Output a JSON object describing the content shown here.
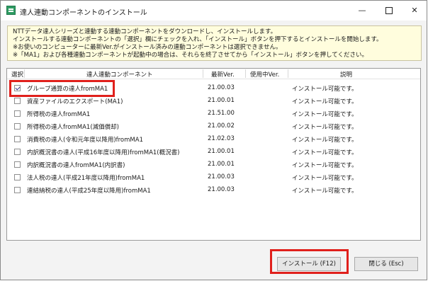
{
  "window": {
    "title": "達人連動コンポーネントのインストール",
    "minimize_glyph": "—",
    "close_glyph": "✕"
  },
  "info_lines": [
    "NTTデータ達人シリーズと連動する連動コンポーネントをダウンロードし、インストールします。",
    "インストールする連動コンポーネントの「選択」欄にチェックを入れ、「インストール」ボタンを押下するとインストールを開始します。",
    "※お使いのコンピューターに最新Ver.がインストール済みの連動コンポーネントは選択できません。",
    "※「MA1」および各種連動コンポーネントが起動中の場合は、それらを終了させてから「インストール」ボタンを押してください。"
  ],
  "table": {
    "headers": {
      "select": "選択",
      "component": "達人連動コンポーネント",
      "latest": "最新Ver.",
      "in_use": "使用中Ver.",
      "description": "説明"
    },
    "rows": [
      {
        "checked": true,
        "name": "グループ通算の達人fromMA1",
        "latest": "21.00.03",
        "desc": "インストール可能です。"
      },
      {
        "checked": false,
        "name": "資産ファイルのエクスポート(MA1)",
        "latest": "21.00.01",
        "desc": "インストール可能です。"
      },
      {
        "checked": false,
        "name": "所得税の達人fromMA1",
        "latest": "21.51.00",
        "desc": "インストール可能です。"
      },
      {
        "checked": false,
        "name": "所得税の達人fromMA1(減価償却)",
        "latest": "21.00.02",
        "desc": "インストール可能です。"
      },
      {
        "checked": false,
        "name": "消費税の達人(令和元年度以降用)fromMA1",
        "latest": "21.02.03",
        "desc": "インストール可能です。"
      },
      {
        "checked": false,
        "name": "内訳概況書の達人(平成16年度以降用)fromMA1(概況書)",
        "latest": "21.00.01",
        "desc": "インストール可能です。"
      },
      {
        "checked": false,
        "name": "内訳概況書の達人fromMA1(内訳書)",
        "latest": "21.00.01",
        "desc": "インストール可能です。"
      },
      {
        "checked": false,
        "name": "法人税の達人(平成21年度以降用)fromMA1",
        "latest": "21.00.03",
        "desc": "インストール可能です。"
      },
      {
        "checked": false,
        "name": "連結納税の達人(平成25年度以降用)fromMA1",
        "latest": "21.00.03",
        "desc": "インストール可能です。"
      }
    ]
  },
  "buttons": {
    "install": "インストール (F12)",
    "close": "閉じる (Esc)"
  },
  "colors": {
    "highlight": "#e0201c",
    "info_background": "#fffddd",
    "app_icon": "#2e9b63"
  }
}
